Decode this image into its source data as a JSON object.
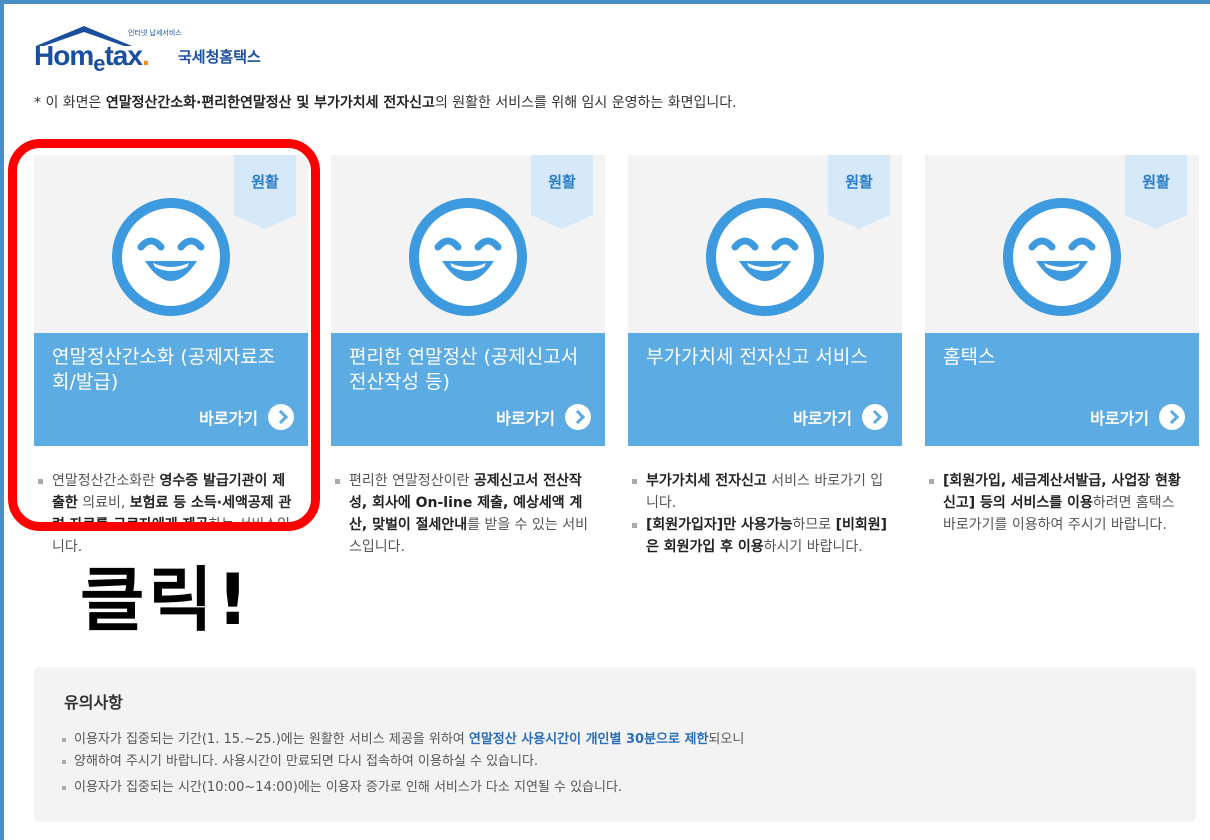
{
  "logo": {
    "tagline": "인터넷 납세서비스",
    "brand_a": "Hom",
    "brand_e": "e",
    "brand_tax": "tax",
    "brand_dot": ".",
    "korean": "국세청홈택스"
  },
  "notice": {
    "prefix": "* 이 화면은 ",
    "bold": "연말정산간소화·편리한연말정산 및 부가가치세 전자신고",
    "suffix": "의 원활한 서비스를 위해 임시 운영하는 화면입니다."
  },
  "cards": [
    {
      "status": "원활",
      "title": "연말정산간소화 (공제자료조회/발급)",
      "go": "바로가기",
      "desc": [
        {
          "t1": "연말정산간소화란 ",
          "b1": "영수증 발급기관이 제출한",
          "t2": " 의료비, ",
          "b2": "보험료 등 소득·세액공제 관련 자료를 근로자에게 제공",
          "t3": "하는 서비스입니다."
        }
      ]
    },
    {
      "status": "원활",
      "title": "편리한 연말정산 (공제신고서 전산작성 등)",
      "go": "바로가기",
      "desc": [
        {
          "t1": "편리한 연말정산이란 ",
          "b1": "공제신고서 전산작성, 회사에 On-line 제출, 예상세액 계산, 맞벌이 절세안내",
          "t2": "를 받을 수 있는 서비스입니다.",
          "b2": "",
          "t3": ""
        }
      ]
    },
    {
      "status": "원활",
      "title": "부가가치세 전자신고 서비스",
      "go": "바로가기",
      "desc": [
        {
          "t1": "",
          "b1": "부가가치세 전자신고",
          "t2": " 서비스 바로가기 입니다.",
          "b2": "",
          "t3": ""
        },
        {
          "t1": "",
          "b1": "[회원가입자]만 사용가능",
          "t2": "하므로 ",
          "b2": "[비회원]은 회원가입 후 이용",
          "t3": "하시기 바랍니다."
        }
      ]
    },
    {
      "status": "원활",
      "title": "홈택스",
      "go": "바로가기",
      "desc": [
        {
          "t1": "",
          "b1": "[회원가입, 세금계산서발급, 사업장 현황 신고] 등의 서비스를 이용",
          "t2": "하려면 홈택스 바로가기를 이용하여 주시기 바랍니다.",
          "b2": "",
          "t3": ""
        }
      ]
    }
  ],
  "annotation": {
    "click_text": "클릭!"
  },
  "caution": {
    "title": "유의사항",
    "line1_a": "이용자가 집중되는 기간(1. 15.~25.)에는 원활한 서비스 제공을 위하여 ",
    "line1_b": "연말정산 사용시간이 개인별 30분으로 제한",
    "line1_c": "되오니",
    "line2": "양해하여 주시기 바랍니다. 사용시간이 만료되면 다시 접속하여 이용하실 수 있습니다.",
    "line3": "이용자가 집중되는 시간(10:00~14:00)에는 이용자 증가로 인해 서비스가 다소 지연될 수 있습니다."
  },
  "colors": {
    "accent": "#5dabe3",
    "badge": "#d6e9f8",
    "highlight": "#ff0000",
    "brand": "#1a4fa0"
  }
}
